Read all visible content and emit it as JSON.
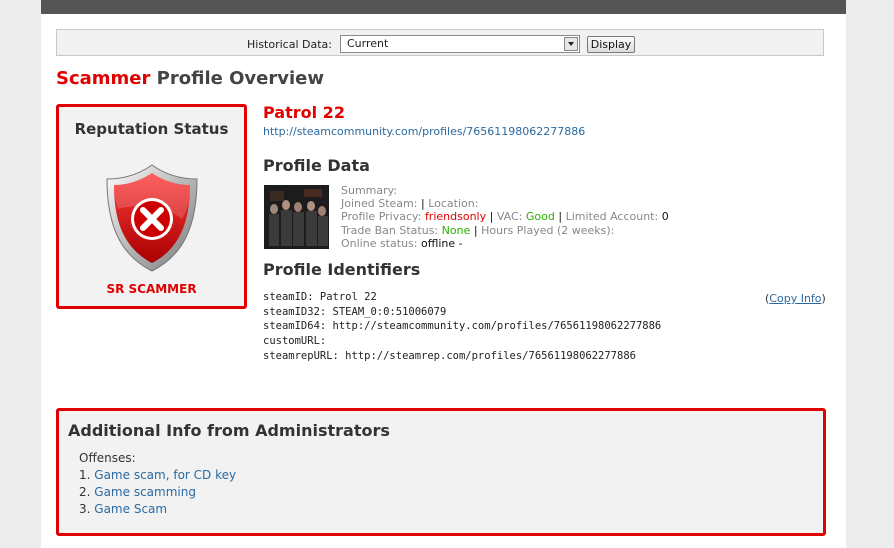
{
  "historical": {
    "label": "Historical Data:",
    "selected": "Current",
    "button": "Display"
  },
  "page_title": {
    "highlight": "Scammer",
    "rest": "Profile Overview"
  },
  "reputation": {
    "title": "Reputation Status",
    "status": "SR SCAMMER",
    "icon": "scammer-shield-icon",
    "color": "#e00000"
  },
  "profile": {
    "name": "Patrol 22",
    "url": "http://steamcommunity.com/profiles/76561198062277886"
  },
  "profile_data": {
    "heading": "Profile Data",
    "summary_label": "Summary:",
    "joined_label": "Joined Steam:",
    "location_label": "Location:",
    "privacy_label": "Profile Privacy:",
    "privacy_value": "friendsonly",
    "vac_label": "VAC:",
    "vac_value": "Good",
    "limited_label": "Limited Account:",
    "limited_value": "0",
    "tradeban_label": "Trade Ban Status:",
    "tradeban_value": "None",
    "hours_label": "Hours Played (2 weeks):",
    "online_label": "Online status:",
    "online_value": "offline -"
  },
  "identifiers": {
    "heading": "Profile Identifiers",
    "copy_link": "Copy Info",
    "rows": [
      "steamID: Patrol 22",
      "steamID32: STEAM_0:0:51006079",
      "steamID64: http://steamcommunity.com/profiles/76561198062277886",
      "customURL:",
      "steamrepURL: http://steamrep.com/profiles/76561198062277886"
    ]
  },
  "admin": {
    "heading": "Additional Info from Administrators",
    "offenses_label": "Offenses:",
    "offenses": [
      {
        "num": "1.",
        "text": "Game scam, for CD key"
      },
      {
        "num": "2.",
        "text": "Game scamming"
      },
      {
        "num": "3.",
        "text": "Game Scam"
      }
    ]
  }
}
